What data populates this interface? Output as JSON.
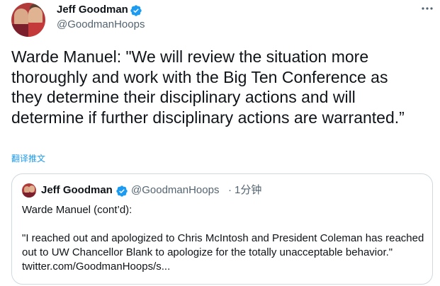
{
  "tweet": {
    "author": {
      "display_name": "Jeff Goodman",
      "handle": "@GoodmanHoops",
      "verified_icon": "verified-badge-icon",
      "avatar": "avatar-photo"
    },
    "more_icon": "more-options-icon",
    "text": "Warde Manuel: \"We will review the situation more thoroughly and work with the Big Ten Conference as they determine their disciplinary actions and will determine if further disciplinary actions are warranted.”",
    "translate_label": "翻译推文"
  },
  "quoted_tweet": {
    "author": {
      "display_name": "Jeff Goodman",
      "handle": "@GoodmanHoops",
      "verified_icon": "verified-badge-icon"
    },
    "separator": "·",
    "time": "1分钟",
    "text": "Warde Manuel (cont’d):\n\n\"I reached out and apologized to Chris McIntosh and President Coleman has reached out to UW Chancellor Blank to apologize for the totally unacceptable behavior.\" twitter.com/GoodmanHoops/s..."
  },
  "colors": {
    "text_primary": "#0f1419",
    "text_secondary": "#536471",
    "accent_blue": "#1d9bf0",
    "border": "#cfd9de"
  }
}
